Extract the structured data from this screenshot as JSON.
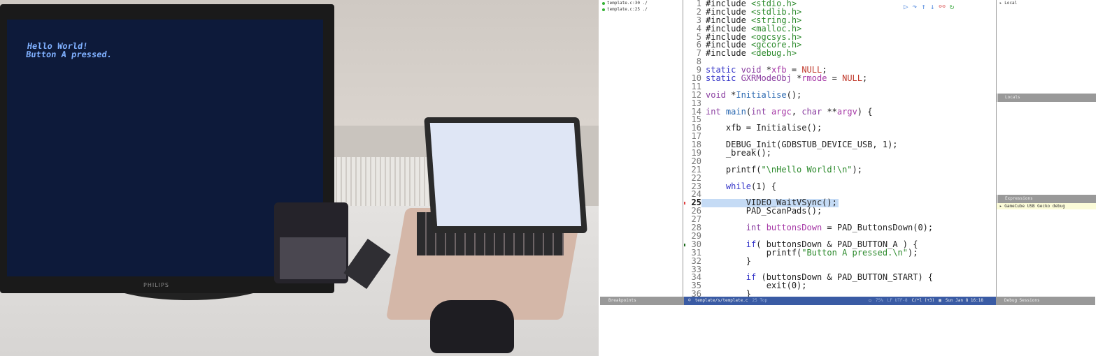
{
  "photo": {
    "monitor_lines": [
      "Hello World!",
      "Button A pressed."
    ],
    "monitor_brand": "PHILIPS"
  },
  "breakpoints_list": [
    "template.c:30 ./",
    "template.c:25 ./"
  ],
  "toolbar_icons": [
    "continue-icon",
    "step-over-icon",
    "step-out-icon",
    "step-into-icon",
    "disconnect-icon",
    "restart-icon"
  ],
  "code": {
    "current_line": 25,
    "breakpoint_line": 30,
    "lines": [
      [
        [
          "#include ",
          ""
        ],
        [
          "<stdio.h>",
          "s"
        ]
      ],
      [
        [
          "#include ",
          ""
        ],
        [
          "<stdlib.h>",
          "s"
        ]
      ],
      [
        [
          "#include ",
          ""
        ],
        [
          "<string.h>",
          "s"
        ]
      ],
      [
        [
          "#include ",
          ""
        ],
        [
          "<malloc.h>",
          "s"
        ]
      ],
      [
        [
          "#include ",
          ""
        ],
        [
          "<ogcsys.h>",
          "s"
        ]
      ],
      [
        [
          "#include ",
          ""
        ],
        [
          "<gccore.h>",
          "s"
        ]
      ],
      [
        [
          "#include ",
          ""
        ],
        [
          "<debug.h>",
          "s"
        ]
      ],
      [],
      [
        [
          "static ",
          "k"
        ],
        [
          "void ",
          "t"
        ],
        [
          "*",
          ""
        ],
        [
          "xfb",
          "v"
        ],
        [
          " = ",
          ""
        ],
        [
          "NULL",
          "n"
        ],
        [
          ";",
          ""
        ]
      ],
      [
        [
          "static ",
          "k"
        ],
        [
          "GXRModeObj ",
          "t"
        ],
        [
          "*",
          ""
        ],
        [
          "rmode",
          "v"
        ],
        [
          " = ",
          ""
        ],
        [
          "NULL",
          "n"
        ],
        [
          ";",
          ""
        ]
      ],
      [],
      [
        [
          "void ",
          "t"
        ],
        [
          "*",
          ""
        ],
        [
          "Initialise",
          "f"
        ],
        [
          "();",
          ""
        ]
      ],
      [],
      [
        [
          "int ",
          "t"
        ],
        [
          "main",
          "f"
        ],
        [
          "(",
          ""
        ],
        [
          "int ",
          "t"
        ],
        [
          "argc",
          "v"
        ],
        [
          ", ",
          ""
        ],
        [
          "char ",
          "t"
        ],
        [
          "**",
          ""
        ],
        [
          "argv",
          "v"
        ],
        [
          ") {",
          ""
        ]
      ],
      [],
      [
        [
          "    xfb = Initialise();",
          ""
        ]
      ],
      [],
      [
        [
          "    DEBUG_Init(GDBSTUB_DEVICE_USB, 1);",
          ""
        ]
      ],
      [
        [
          "    _break();",
          ""
        ]
      ],
      [],
      [
        [
          "    printf(",
          ""
        ],
        [
          "\"\\nHello World!\\n\"",
          "s"
        ],
        [
          ");",
          ""
        ]
      ],
      [],
      [
        [
          "    ",
          ""
        ],
        [
          "while",
          "k"
        ],
        [
          "(1) {",
          ""
        ]
      ],
      [],
      [
        [
          "        VIDEO_WaitVSync();",
          ""
        ]
      ],
      [
        [
          "        PAD_ScanPads();",
          ""
        ]
      ],
      [],
      [
        [
          "        ",
          ""
        ],
        [
          "int ",
          "t"
        ],
        [
          "buttonsDown",
          "v"
        ],
        [
          " = PAD_ButtonsDown(0);",
          ""
        ]
      ],
      [],
      [
        [
          "        ",
          ""
        ],
        [
          "if",
          "k"
        ],
        [
          "( buttonsDown & PAD_BUTTON_A ) {",
          ""
        ]
      ],
      [
        [
          "            printf(",
          ""
        ],
        [
          "\"Button A pressed.\\n\"",
          "s"
        ],
        [
          ");",
          ""
        ]
      ],
      [
        [
          "        }",
          ""
        ]
      ],
      [],
      [
        [
          "        ",
          ""
        ],
        [
          "if",
          "k"
        ],
        [
          " (buttonsDown & PAD_BUTTON_START) {",
          ""
        ]
      ],
      [
        [
          "            exit(0);",
          ""
        ]
      ],
      [
        [
          "        }",
          ""
        ]
      ]
    ]
  },
  "right_panel": {
    "local_item": "▸ Local",
    "locals_header": "Locals",
    "expressions_header": "Expressions",
    "expression_item": "▸ GameCube USB Gecko debug"
  },
  "status": {
    "breakpoints": "Breakpoints",
    "file": "template/s/template.c",
    "position": "25 Top",
    "battery": "75%",
    "eol": "LF UTF-8",
    "mode": "C/*l (+3)",
    "datetime": "Sun Jan  8 16:18",
    "debug_sessions": "Debug Sessions"
  },
  "colors": {
    "status_blue": "#3a5ba4",
    "highlight": "#c5dbf5",
    "panel_gray": "#999999"
  }
}
